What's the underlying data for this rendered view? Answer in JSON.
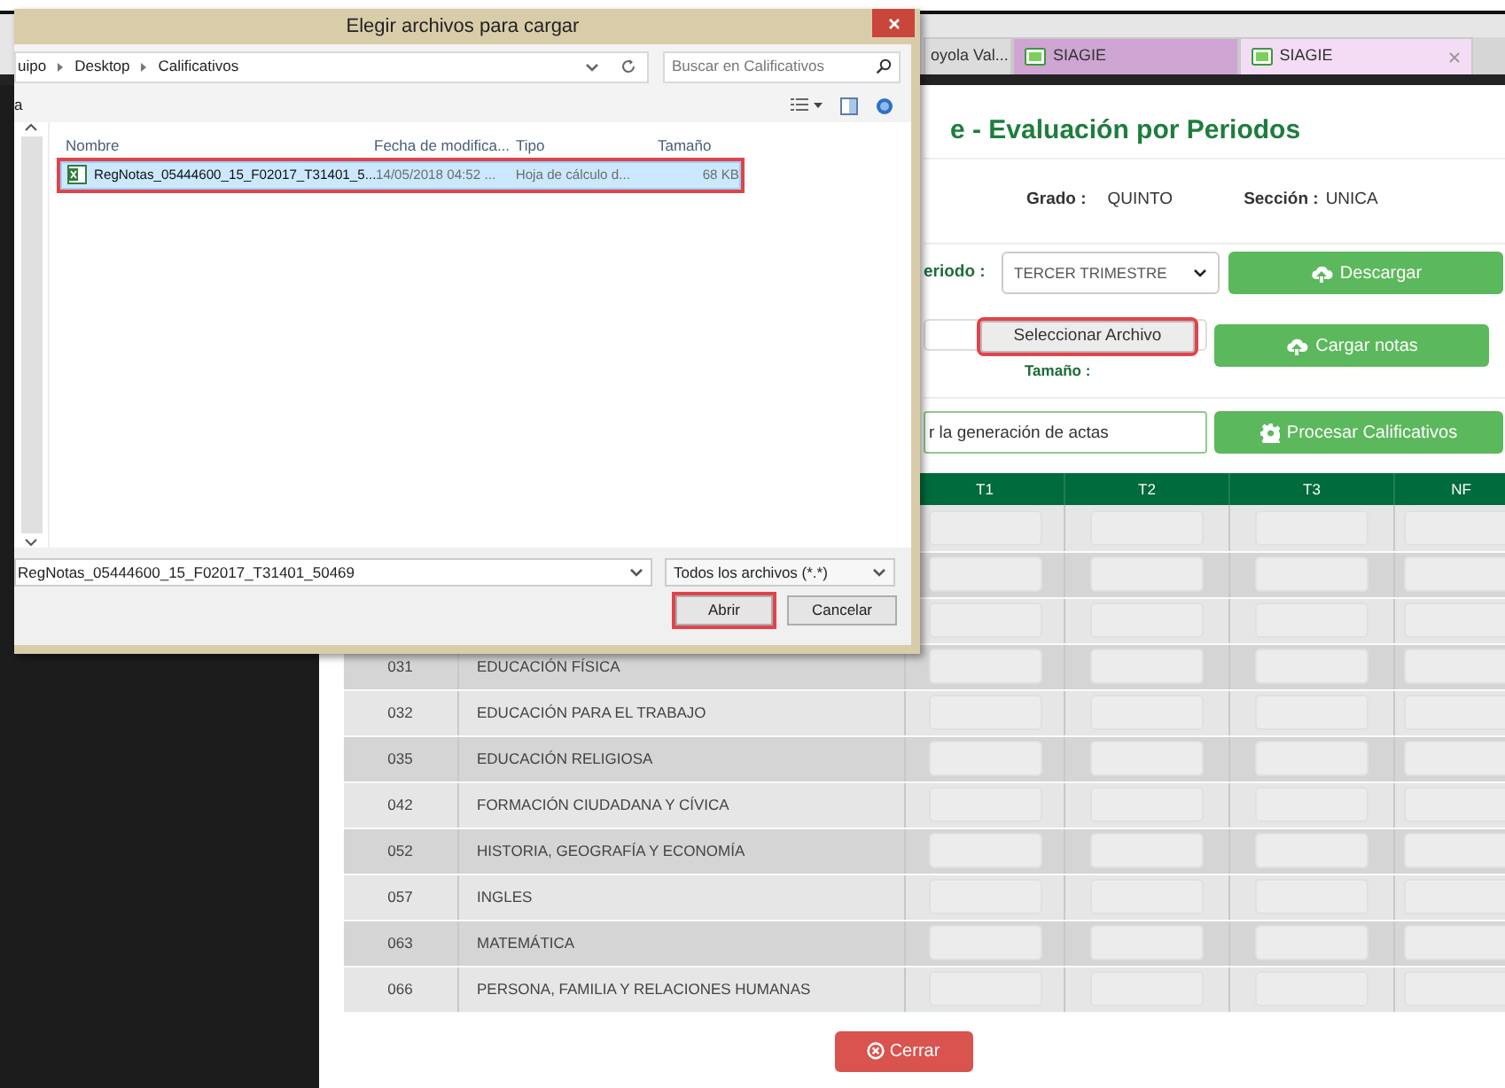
{
  "dialog": {
    "title": "Elegir archivos para cargar",
    "path": [
      "uipo",
      "Desktop",
      "Calificativos"
    ],
    "search": {
      "placeholder": "Buscar en Calificativos"
    },
    "nav_label": "a",
    "columns": [
      "Nombre",
      "Fecha de modifica...",
      "Tipo",
      "Tamaño"
    ],
    "files": [
      {
        "name": "RegNotas_05444600_15_F02017_T31401_5...",
        "date": "14/05/2018 04:52 ...",
        "type": "Hoja de cálculo d...",
        "size": "68 KB",
        "selected": true,
        "highlighted": true
      }
    ],
    "file_name": "RegNotas_05444600_15_F02017_T31401_50469",
    "filter": "Todos los archivos (*.*)",
    "buttons": [
      {
        "label": "Abrir",
        "highlighted": true
      },
      {
        "label": "Cancelar",
        "highlighted": false
      }
    ]
  },
  "browser_tabs": [
    {
      "title": "oyola Val...",
      "selected": false,
      "kind": "plain"
    },
    {
      "title": "SIAGIE",
      "selected": false,
      "kind": "site"
    },
    {
      "title": "SIAGIE",
      "selected": true,
      "kind": "site"
    }
  ],
  "page": {
    "title": "e - Evaluación por Periodos",
    "info": [
      {
        "label": "Grado :",
        "value": "QUINTO"
      },
      {
        "label": "Sección :",
        "value": "UNICA"
      }
    ],
    "periodo": {
      "label": "eriodo :",
      "value": "TERCER TRIMESTRE"
    },
    "download_button": "Descargar",
    "file_button": {
      "label": "Seleccionar Archivo",
      "highlighted": true
    },
    "size_label": "Tamaño :",
    "upload_button": "Cargar notas",
    "note_field": {
      "value": "r la generación de actas"
    },
    "process_button": "Procesar Calificativos",
    "table": {
      "columns": [
        "T1",
        "T2",
        "T3",
        "NF"
      ],
      "rows": [
        {
          "kind": "covered"
        },
        {
          "kind": "covered"
        },
        {
          "kind": "covered"
        },
        {
          "kind": "subject",
          "code": "031",
          "name": "EDUCACIÓN FÍSICA"
        },
        {
          "kind": "subject",
          "code": "032",
          "name": "EDUCACIÓN PARA EL TRABAJO"
        },
        {
          "kind": "subject",
          "code": "035",
          "name": "EDUCACIÓN RELIGIOSA"
        },
        {
          "kind": "subject",
          "code": "042",
          "name": "FORMACIÓN CIUDADANA Y CÍVICA"
        },
        {
          "kind": "subject",
          "code": "052",
          "name": "HISTORIA, GEOGRAFÍA Y ECONOMÍA"
        },
        {
          "kind": "subject",
          "code": "057",
          "name": "INGLES"
        },
        {
          "kind": "subject",
          "code": "063",
          "name": "MATEMÁTICA"
        },
        {
          "kind": "subject",
          "code": "066",
          "name": "PERSONA, FAMILIA Y RELACIONES HUMANAS"
        }
      ]
    },
    "close_button": "Cerrar"
  }
}
